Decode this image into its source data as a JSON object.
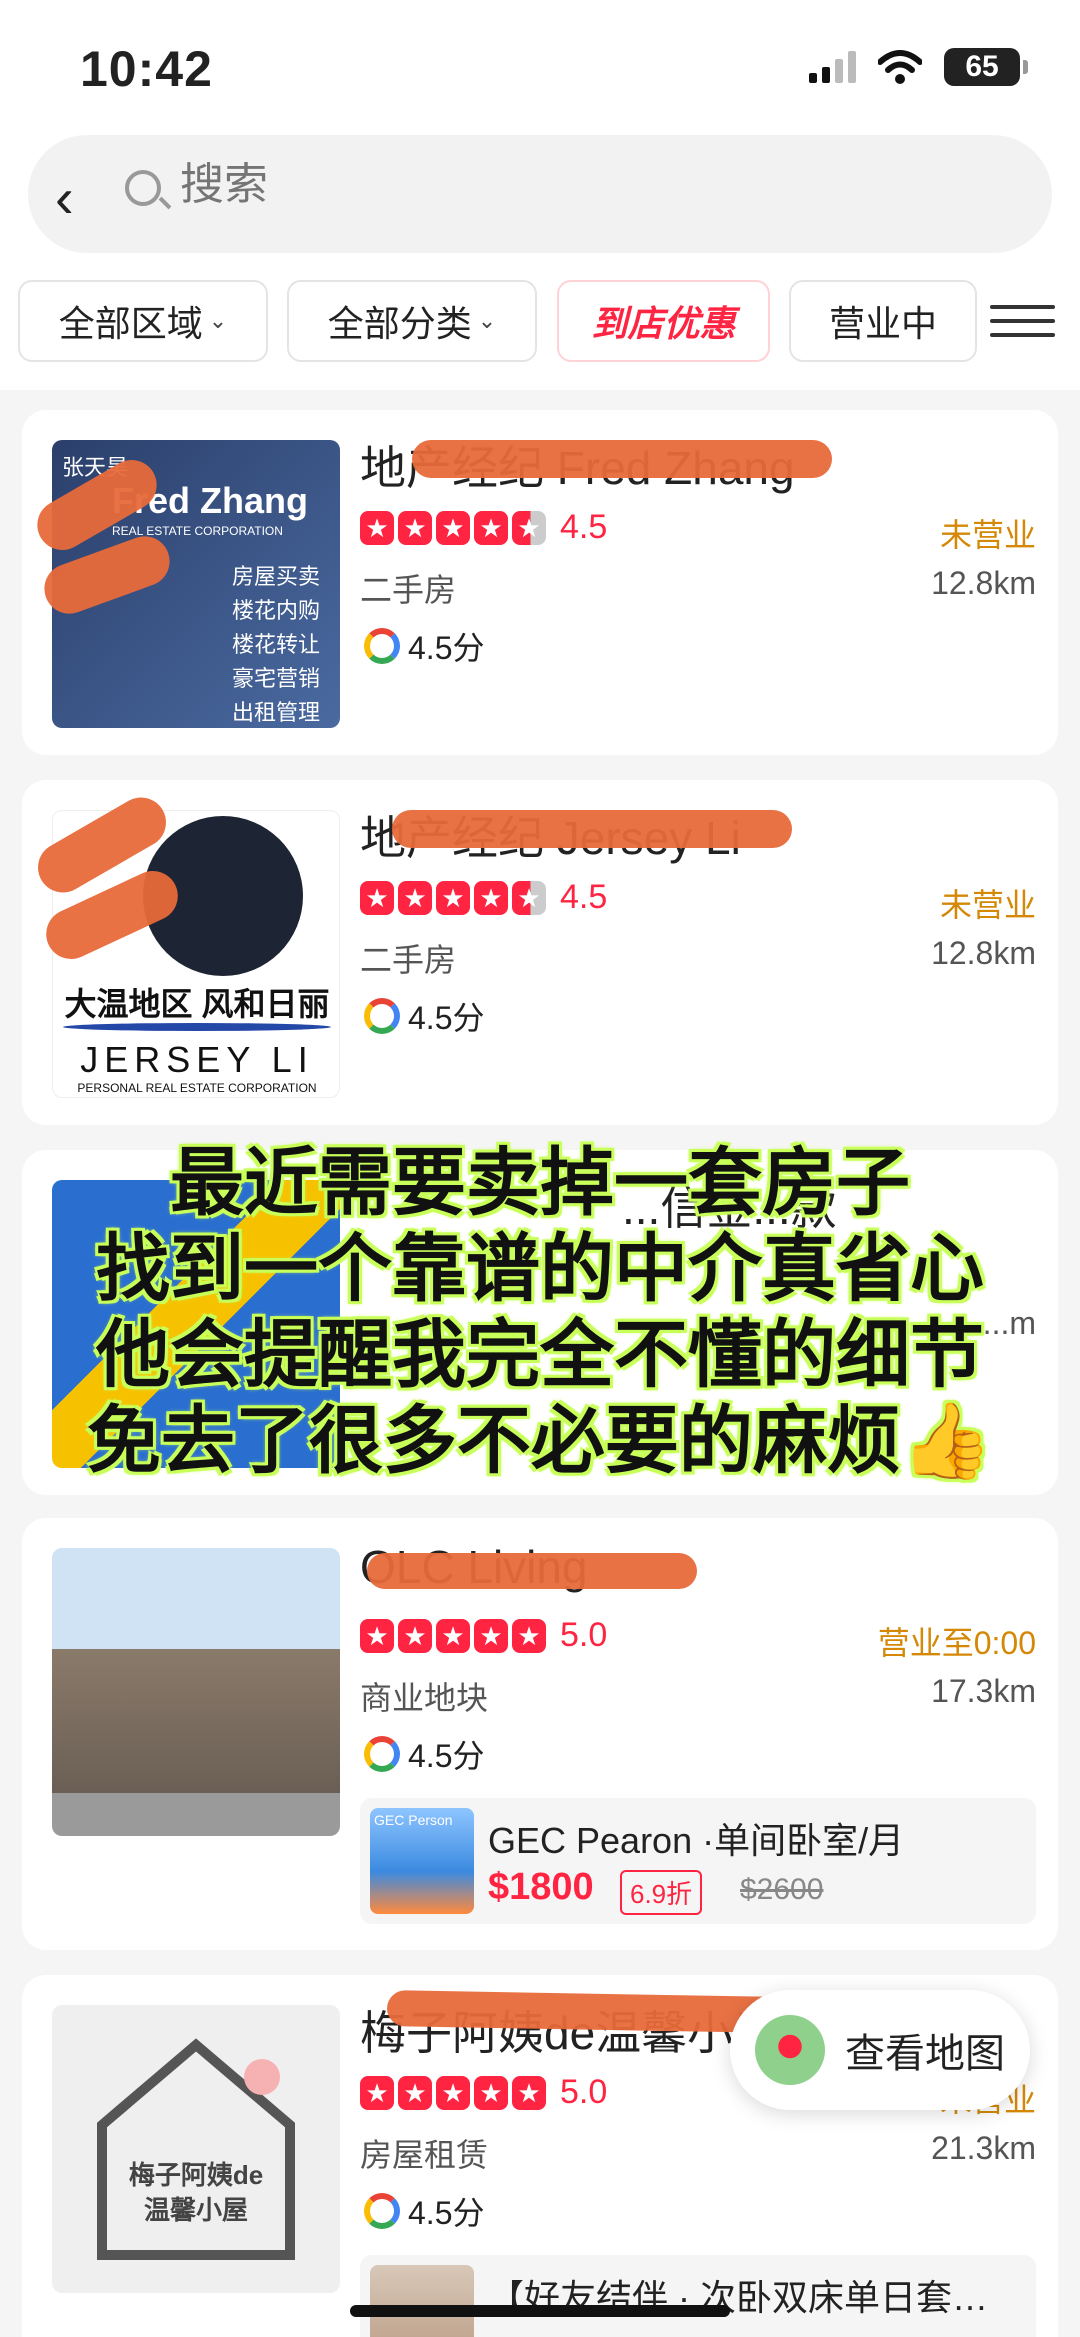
{
  "status_bar": {
    "time": "10:42",
    "battery": "65"
  },
  "search": {
    "placeholder": "搜索"
  },
  "filters": [
    {
      "label": "全部区域",
      "caret": "⌄"
    },
    {
      "label": "全部分类",
      "caret": "⌄"
    },
    {
      "label": "到店优惠"
    },
    {
      "label": "营业中"
    }
  ],
  "listings": [
    {
      "title": "地产经纪 Fred Zhang",
      "rating": "4.5",
      "category": "二手房",
      "google_score": "4.5分",
      "status": "未营业",
      "distance": "12.8km",
      "thumb_lines": [
        "张天昊",
        "Fred Zhang",
        "REAL ESTATE CORPORATION",
        "房屋买卖",
        "楼花内购",
        "楼花转让",
        "豪宅营销",
        "出租管理"
      ]
    },
    {
      "title": "地产经纪 Jersey Li",
      "rating": "4.5",
      "category": "二手房",
      "google_score": "4.5分",
      "status": "未营业",
      "distance": "12.8km",
      "thumb_lines": [
        "大温地区 风和日丽",
        "JERSEY LI",
        "PERSONAL REAL ESTATE CORPORATION"
      ]
    },
    {
      "title": "...信金...款",
      "distance": "...m"
    },
    {
      "title": "OLC Living",
      "rating": "5.0",
      "category": "商业地块",
      "google_score": "4.5分",
      "status": "营业至0:00",
      "distance": "17.3km",
      "deal": {
        "thumb_label": "GEC Person",
        "title": "GEC Pearon ·单间卧室/月",
        "price": "$1800",
        "discount": "6.9折",
        "original": "$2600"
      }
    },
    {
      "title": "梅子阿姨de温馨小屋",
      "rating": "5.0",
      "category": "房屋租赁",
      "google_score": "4.5分",
      "status": "未营业",
      "distance": "21.3km",
      "thumb_lines": [
        "梅子阿姨de",
        "温馨小屋"
      ],
      "deal": {
        "title": "【好友结伴 · 次卧双床单日套…"
      }
    }
  ],
  "caption": [
    "最近需要卖掉一套房子",
    "找到一个靠谱的中介真省心",
    "他会提醒我完全不懂的细节",
    "免去了很多不必要的麻烦👍"
  ],
  "map_button": {
    "label": "查看地图"
  },
  "colors": {
    "accent": "#ff2442",
    "status_closed": "#d48806",
    "caption_glow": "#c8ff5a"
  }
}
